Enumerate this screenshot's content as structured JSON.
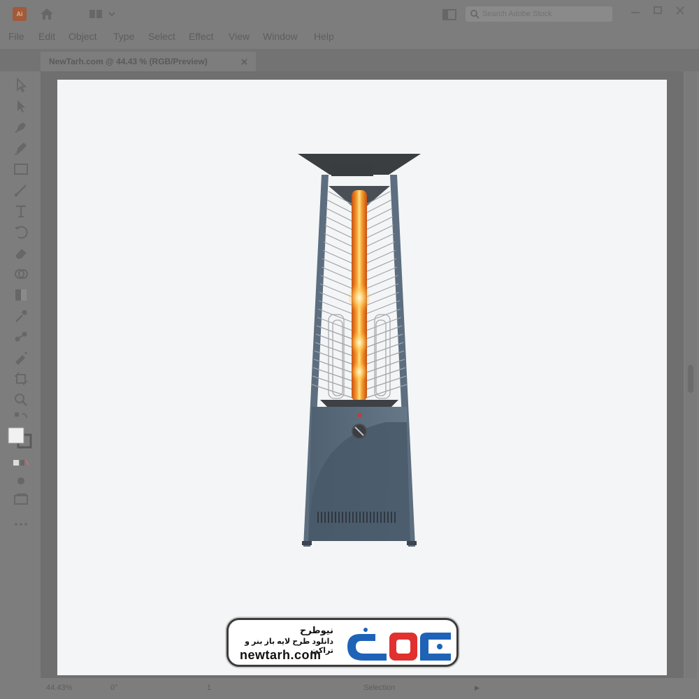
{
  "app": {
    "logo_text": "Ai",
    "search_placeholder": "Search Adobe Stock"
  },
  "menu": {
    "items": [
      "File",
      "Edit",
      "Object",
      "Type",
      "Select",
      "Effect",
      "View",
      "Window",
      "Help"
    ]
  },
  "tab": {
    "title": "NewTarh.com @ 44.43 % (RGB/Preview)"
  },
  "tools": {
    "icons": [
      "selection-icon",
      "direct-selection-icon",
      "pen-icon",
      "curvature-icon",
      "rectangle-icon",
      "paintbrush-icon",
      "type-icon",
      "rotate-icon",
      "eraser-icon",
      "shape-builder-icon",
      "gradient-icon",
      "eyedropper-icon",
      "blend-icon",
      "symbol-sprayer-icon",
      "artboard-icon",
      "zoom-icon",
      "swap-colors-icon",
      "fill-stroke-icon",
      "color-mode-icon",
      "draw-mode-icon",
      "screen-mode-icon",
      "more-tools-icon"
    ]
  },
  "status": {
    "zoom": "44.43%",
    "angle": "0°",
    "artboard": "1",
    "mode": "Selection"
  },
  "watermark": {
    "title": "نیوطرح",
    "subtitle": "دانلود طرح لایه باز بنر و تراکت",
    "url": "newtarh.com",
    "logo_text": "نیوطرح"
  },
  "colors": {
    "chrome": "#7d7d7d",
    "artboard": "#f4f5f6",
    "heater_body": "#5c6e7f",
    "logo_blue": "#1e63b8",
    "logo_red": "#e03030"
  }
}
